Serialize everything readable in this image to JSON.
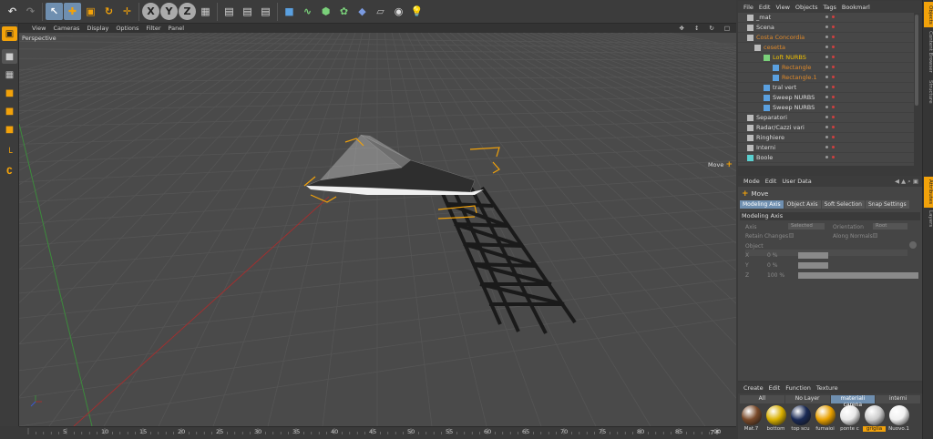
{
  "viewport": {
    "menu": [
      "View",
      "Cameras",
      "Display",
      "Options",
      "Filter",
      "Panel"
    ],
    "label": "Perspective",
    "move_hint": "Move"
  },
  "timeline": {
    "ticks": [
      "5",
      "10",
      "15",
      "20",
      "25",
      "30",
      "35",
      "40",
      "45",
      "50",
      "55",
      "60",
      "65",
      "70",
      "75",
      "80",
      "85",
      "90"
    ],
    "current_frame": "7 F"
  },
  "toolbar": {
    "axis_x": "X",
    "axis_y": "Y",
    "axis_z": "Z"
  },
  "object_manager": {
    "menu": [
      "File",
      "Edit",
      "View",
      "Objects",
      "Tags",
      "Bookmarl"
    ],
    "rows": [
      {
        "name": "_mat",
        "color": "#dddddd"
      },
      {
        "name": "Scena",
        "color": "#dddddd"
      },
      {
        "name": "Costa Concordia",
        "color": "#e08a2a"
      },
      {
        "name": "cesetta",
        "color": "#e08a2a"
      },
      {
        "name": "Loft NURBS",
        "color": "#f2c200"
      },
      {
        "name": "Rectangle",
        "color": "#e08a2a"
      },
      {
        "name": "Rectangle.1",
        "color": "#e08a2a"
      },
      {
        "name": "tral vert",
        "color": "#dddddd"
      },
      {
        "name": "Sweep NURBS",
        "color": "#dddddd"
      },
      {
        "name": "Sweep NURBS",
        "color": "#dddddd"
      },
      {
        "name": "Separatori",
        "color": "#dddddd"
      },
      {
        "name": "Radar/Cazzi vari",
        "color": "#dddddd"
      },
      {
        "name": "Ringhiere",
        "color": "#dddddd"
      },
      {
        "name": "Interni",
        "color": "#dddddd"
      },
      {
        "name": "Boole",
        "color": "#dddddd"
      }
    ]
  },
  "right_tabs": [
    "Objects",
    "Content Browser",
    "Structure",
    "Attributes",
    "Layers"
  ],
  "attributes": {
    "menu": [
      "Mode",
      "Edit",
      "User Data"
    ],
    "title": "Move",
    "tabs": [
      "Modeling Axis",
      "Object Axis",
      "Soft Selection",
      "Snap Settings"
    ],
    "section": "Modeling Axis",
    "axis_label": "Axis",
    "axis_value": "Selected",
    "orientation_label": "Orientation",
    "orientation_value": "Root",
    "retain_changes": "Retain Changes",
    "along_normals": "Along Normals",
    "object_label": "Object",
    "x_label": "X",
    "x_value": "0 %",
    "y_label": "Y",
    "y_value": "0 %",
    "z_label": "Z",
    "z_value": "100 %",
    "x_fill": 0.5,
    "y_fill": 0.5,
    "z_fill": 1.0
  },
  "materials": {
    "menu": [
      "Create",
      "Edit",
      "Function",
      "Texture"
    ],
    "layers": [
      "All",
      "No Layer",
      "materiali carena",
      "interni"
    ],
    "active_layer": "materiali carena",
    "items": [
      {
        "name": "Mat.7",
        "color": "#7a4a2a"
      },
      {
        "name": "bottom",
        "color": "#d9b000"
      },
      {
        "name": "top scu",
        "color": "#1a2a55"
      },
      {
        "name": "fumaioi",
        "color": "#e8a000"
      },
      {
        "name": "ponte c",
        "color": "#e8e8e8"
      },
      {
        "name": "griglia",
        "color": "#cccccc"
      },
      {
        "name": "Nuovo.1",
        "color": "#f0f0f0"
      }
    ],
    "active_item": "griglia"
  }
}
